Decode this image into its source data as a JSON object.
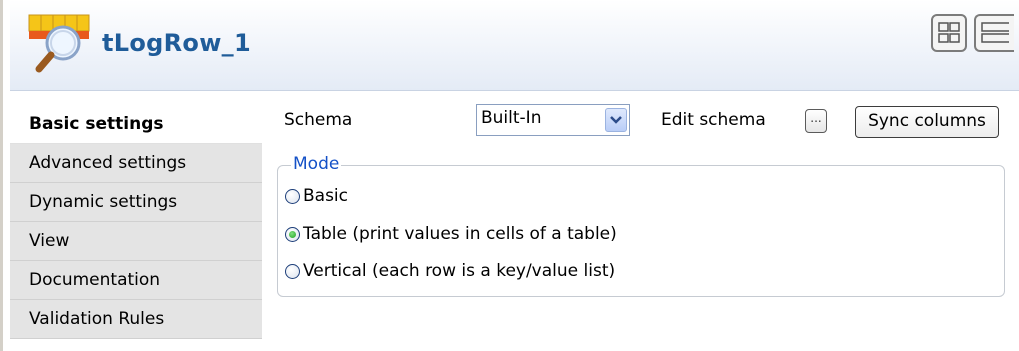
{
  "header": {
    "component_title": "tLogRow_1",
    "icon": "tlogrow-magnifier-icon"
  },
  "sidebar": {
    "tabs": [
      {
        "label": "Basic settings",
        "active": true
      },
      {
        "label": "Advanced settings",
        "active": false
      },
      {
        "label": "Dynamic settings",
        "active": false
      },
      {
        "label": "View",
        "active": false
      },
      {
        "label": "Documentation",
        "active": false
      },
      {
        "label": "Validation Rules",
        "active": false
      }
    ]
  },
  "basic_settings": {
    "schema_label": "Schema",
    "schema_value": "Built-In",
    "edit_schema_label": "Edit schema",
    "edit_schema_button": "...",
    "sync_columns_button": "Sync columns",
    "mode": {
      "legend": "Mode",
      "options": [
        {
          "label": "Basic",
          "selected": false
        },
        {
          "label": "Table (print values in cells of a table)",
          "selected": true
        },
        {
          "label": "Vertical (each row is a key/value list)",
          "selected": false
        }
      ]
    }
  },
  "colors": {
    "title": "#1f5c99",
    "legend": "#1451c7",
    "tab_inactive_bg": "#e4e4e4"
  }
}
